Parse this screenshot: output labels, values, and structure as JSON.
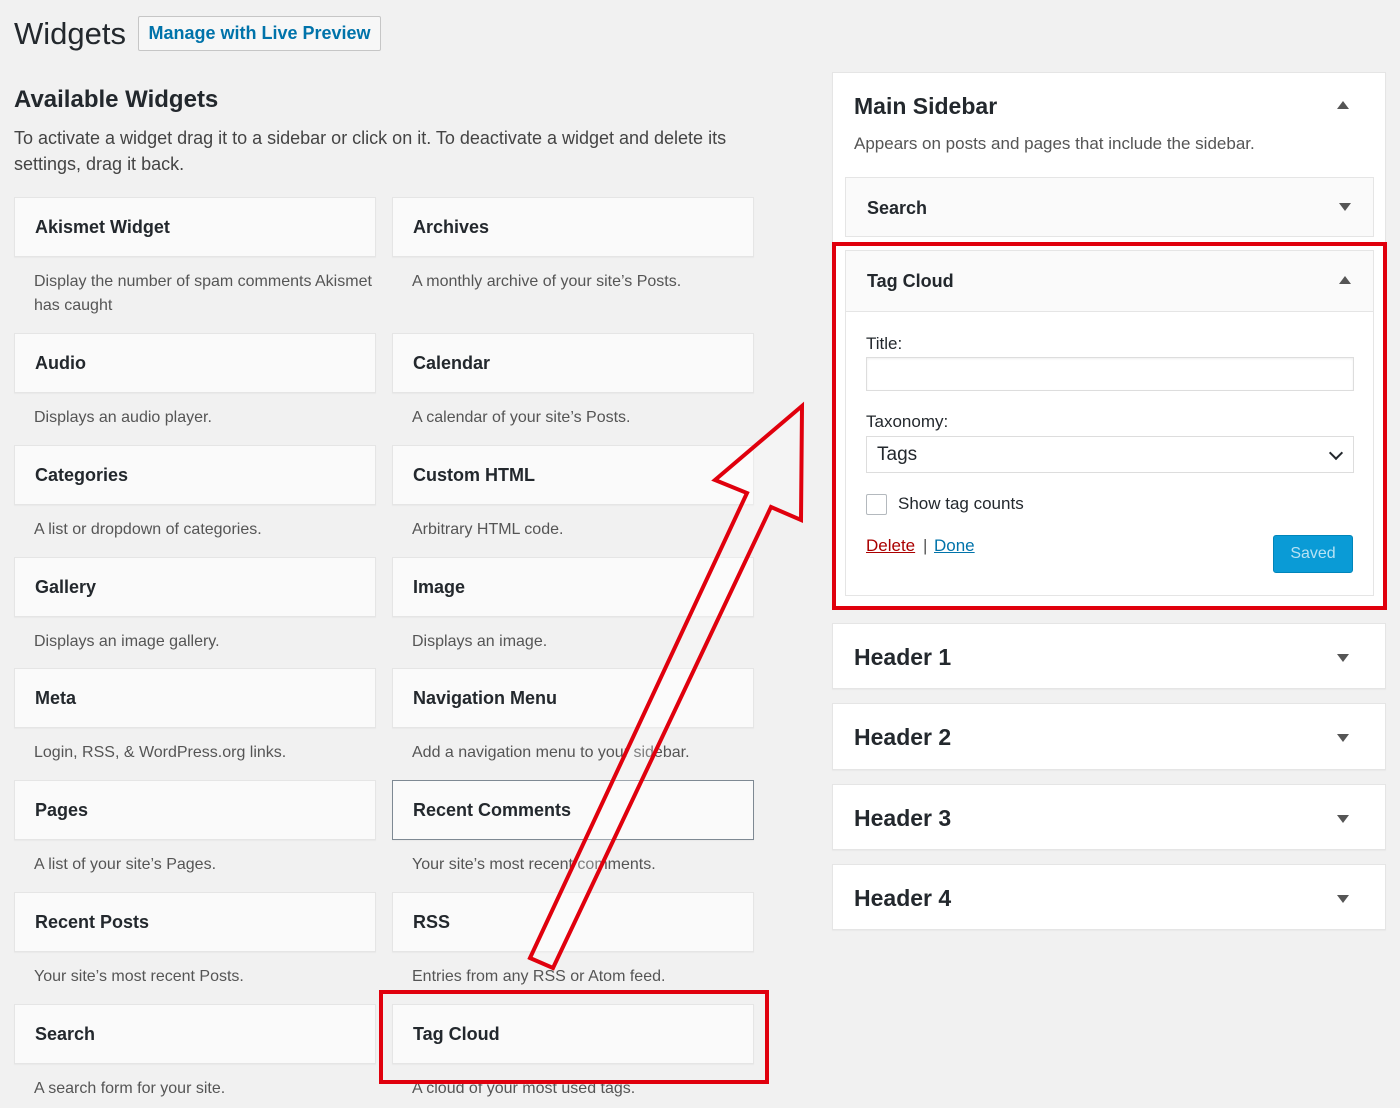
{
  "header": {
    "title": "Widgets",
    "live_preview_label": "Manage with Live Preview"
  },
  "available": {
    "title": "Available Widgets",
    "description": "To activate a widget drag it to a sidebar or click on it. To deactivate a widget and delete its settings, drag it back.",
    "widgets": [
      {
        "name": "Akismet Widget",
        "desc": "Display the number of spam comments Akismet has caught"
      },
      {
        "name": "Archives",
        "desc": "A monthly archive of your site’s Posts."
      },
      {
        "name": "Audio",
        "desc": "Displays an audio player."
      },
      {
        "name": "Calendar",
        "desc": "A calendar of your site’s Posts."
      },
      {
        "name": "Categories",
        "desc": "A list or dropdown of categories."
      },
      {
        "name": "Custom HTML",
        "desc": "Arbitrary HTML code."
      },
      {
        "name": "Gallery",
        "desc": "Displays an image gallery."
      },
      {
        "name": "Image",
        "desc": "Displays an image."
      },
      {
        "name": "Meta",
        "desc": "Login, RSS, & WordPress.org links."
      },
      {
        "name": "Navigation Menu",
        "desc": "Add a navigation menu to your sidebar."
      },
      {
        "name": "Pages",
        "desc": "A list of your site’s Pages."
      },
      {
        "name": "Recent Comments",
        "desc": "Your site’s most recent comments."
      },
      {
        "name": "Recent Posts",
        "desc": "Your site’s most recent Posts."
      },
      {
        "name": "RSS",
        "desc": "Entries from any RSS or Atom feed."
      },
      {
        "name": "Search",
        "desc": "A search form for your site."
      },
      {
        "name": "Tag Cloud",
        "desc": "A cloud of your most used tags."
      }
    ]
  },
  "main_sidebar": {
    "title": "Main Sidebar",
    "description": "Appears on posts and pages that include the sidebar.",
    "search_widget": "Search",
    "tag_cloud": {
      "title": "Tag Cloud",
      "title_label": "Title:",
      "title_value": "",
      "taxonomy_label": "Taxonomy:",
      "taxonomy_value": "Tags",
      "show_counts_label": "Show tag counts",
      "delete_label": "Delete",
      "separator": "|",
      "done_label": "Done",
      "saved_label": "Saved"
    }
  },
  "other_sidebars": [
    "Header 1",
    "Header 2",
    "Header 3",
    "Header 4"
  ],
  "colors": {
    "accent": "#0073aa",
    "highlight": "#e0000d",
    "saved_button": "#0a9bd6",
    "delete_link": "#a00"
  }
}
